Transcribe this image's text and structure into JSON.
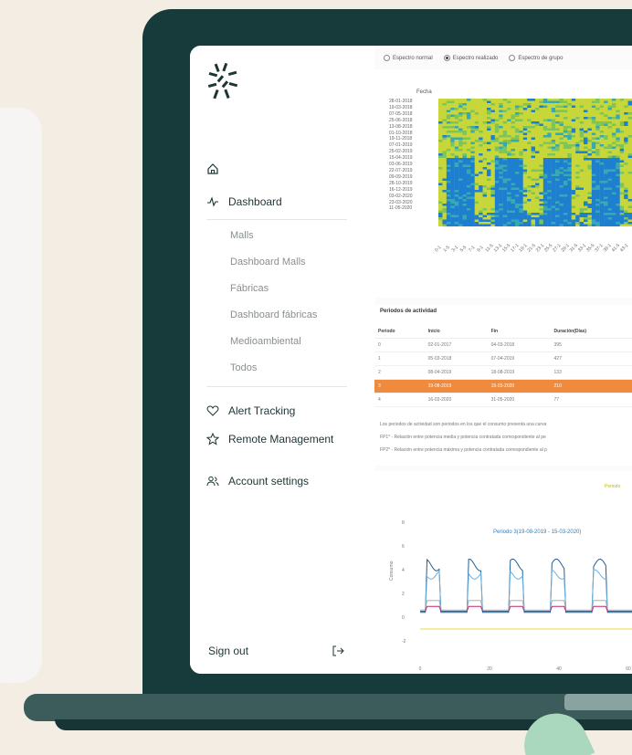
{
  "sidebar": {
    "nav": {
      "dashboard": "Dashboard",
      "alert_tracking": "Alert Tracking",
      "remote_management": "Remote Management",
      "account_settings": "Account settings"
    },
    "sub_items": [
      "Malls",
      "Dashboard Malls",
      "Fábricas",
      "Dashboard fábricas",
      "Medioambiental",
      "Todos"
    ],
    "sign_out": "Sign out"
  },
  "main": {
    "radios": [
      {
        "label": "Espectro normal",
        "selected": false
      },
      {
        "label": "Espectro realizado",
        "selected": true
      },
      {
        "label": "Espectro de grupo",
        "selected": false
      }
    ],
    "heatmap": {
      "ylabel": "Fecha",
      "dates": [
        "28-01-2018",
        "19-03-2018",
        "07-05-2018",
        "25-06-2018",
        "13-08-2018",
        "01-10-2018",
        "19-11-2018",
        "07-01-2019",
        "25-02-2019",
        "15-04-2019",
        "03-06-2019",
        "22-07-2019",
        "09-09-2019",
        "28-10-2019",
        "16-12-2019",
        "03-02-2020",
        "23-03-2020",
        "11-05-2020"
      ],
      "x_ticks": [
        "0-1",
        "1-5",
        "3-1",
        "5-5",
        "7-1",
        "9-1",
        "11-5",
        "13-1",
        "15-5",
        "17-1",
        "19-1",
        "21-5",
        "23-1",
        "25-5",
        "27-1",
        "29-1",
        "31-5",
        "33-1",
        "35-5",
        "37-1",
        "39-1",
        "41-5",
        "43-1"
      ],
      "colors": {
        "yellow": "#c7d638",
        "blue": "#1f7fcf",
        "teal": "#37a9b3",
        "green": "#7fc457"
      }
    },
    "periods": {
      "title": "Periodos de actividad",
      "columns": [
        "Periodo",
        "Inicio",
        "Fin",
        "Duración(Días)"
      ],
      "rows": [
        [
          "0",
          "02-01-2017",
          "04-03-2018",
          "395"
        ],
        [
          "1",
          "05-03-2018",
          "07-04-2019",
          "427"
        ],
        [
          "2",
          "08-04-2019",
          "18-08-2019",
          "133"
        ],
        [
          "3",
          "19-08-2019",
          "15-03-2020",
          "210"
        ],
        [
          "4",
          "16-03-2020",
          "31-05-2020",
          "77"
        ]
      ],
      "highlighted_row": 3,
      "notes": [
        "Los periodos de actividad son periodos en los que el consumo presenta una curva",
        "FP1* - Relación entre potencia media y potencia contratada correspondiente al pe",
        "FP2* - Relación entre potencia máxima y potencia contratada correspondiente al p"
      ]
    },
    "line_chart": {
      "title": "Periodo 3(19-08-2019 - 15-03-2020)",
      "legend_label": "Periodo",
      "ylabel": "Consumo",
      "y_ticks": [
        "8",
        "6",
        "4",
        "2",
        "0",
        "-2"
      ],
      "x_ticks": [
        "0",
        "20",
        "40",
        "60"
      ],
      "series_colors": [
        "#1f5f96",
        "#6fb1dc",
        "#9aa4b0",
        "#c0266e",
        "#e8d94a"
      ]
    }
  }
}
